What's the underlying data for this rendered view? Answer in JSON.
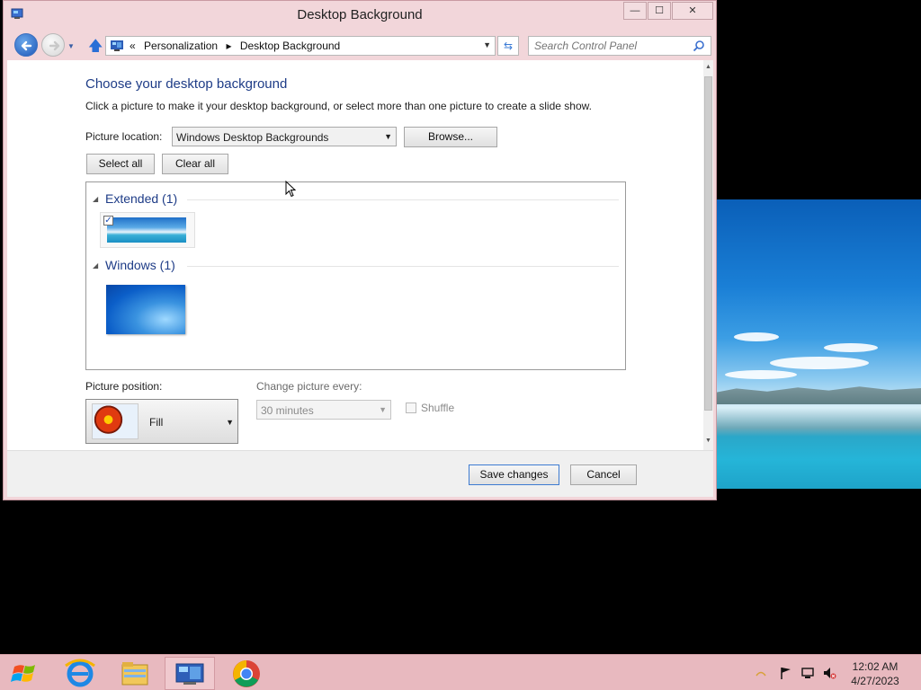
{
  "window": {
    "title": "Desktop Background",
    "controls": {
      "minimize": "—",
      "maximize": "☐",
      "close": "✕"
    }
  },
  "navbar": {
    "crumbs": [
      "«",
      "Personalization",
      "▸",
      "Desktop Background"
    ],
    "search_placeholder": "Search Control Panel"
  },
  "main": {
    "heading": "Choose your desktop background",
    "subtext": "Click a picture to make it your desktop background, or select more than one picture to create a slide show.",
    "picture_location_label": "Picture location:",
    "picture_location_value": "Windows Desktop Backgrounds",
    "browse_label": "Browse...",
    "select_all_label": "Select all",
    "clear_all_label": "Clear all",
    "groups": [
      {
        "title": "Extended (1)",
        "checked": true
      },
      {
        "title": "Windows (1)",
        "checked": false
      }
    ],
    "picture_position_label": "Picture position:",
    "picture_position_value": "Fill",
    "change_every_label": "Change picture every:",
    "change_every_value": "30 minutes",
    "shuffle_label": "Shuffle"
  },
  "footer": {
    "save_label": "Save changes",
    "cancel_label": "Cancel"
  },
  "taskbar": {
    "time": "12:02 AM",
    "date": "4/27/2023"
  }
}
